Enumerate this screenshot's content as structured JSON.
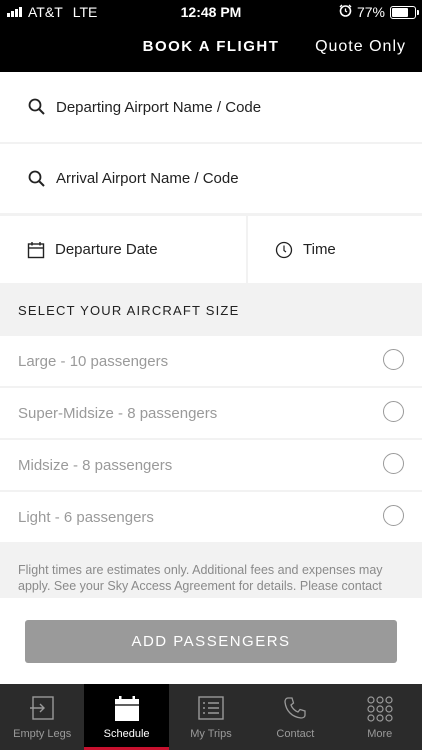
{
  "status_bar": {
    "carrier": "AT&T",
    "network": "LTE",
    "time": "12:48 PM",
    "battery": "77%",
    "battery_level": 0.77,
    "icons": [
      "signal-icon",
      "alarm-icon",
      "battery-icon"
    ]
  },
  "header": {
    "title": "BOOK A FLIGHT",
    "right_action": "Quote Only"
  },
  "form": {
    "departing_placeholder": "Departing Airport Name / Code",
    "arrival_placeholder": "Arrival Airport Name / Code",
    "departure_date_placeholder": "Departure Date",
    "time_placeholder": "Time"
  },
  "aircraft": {
    "heading": "SELECT YOUR AIRCRAFT SIZE",
    "options": [
      {
        "label": "Large - 10 passengers",
        "selected": false
      },
      {
        "label": "Super-Midsize - 8 passengers",
        "selected": false
      },
      {
        "label": "Midsize - 8 passengers",
        "selected": false
      },
      {
        "label": "Light - 6 passengers",
        "selected": false
      }
    ]
  },
  "disclaimer": "Flight times are estimates only. Additional fees and expenses may apply. See your Sky Access Agreement for details. Please contact",
  "primary_button": "ADD PASSENGERS",
  "tabs": [
    {
      "label": "Empty Legs",
      "icon": "empty-legs-icon",
      "active": false
    },
    {
      "label": "Schedule",
      "icon": "calendar-icon",
      "active": true
    },
    {
      "label": "My Trips",
      "icon": "list-icon",
      "active": false
    },
    {
      "label": "Contact",
      "icon": "phone-icon",
      "active": false
    },
    {
      "label": "More",
      "icon": "grid-dots-icon",
      "active": false
    }
  ],
  "colors": {
    "header_bg": "#000000",
    "tab_bar_bg": "#2b2b2b",
    "active_tab_indicator": "#c8102e",
    "button_disabled": "#9a9a9a"
  }
}
